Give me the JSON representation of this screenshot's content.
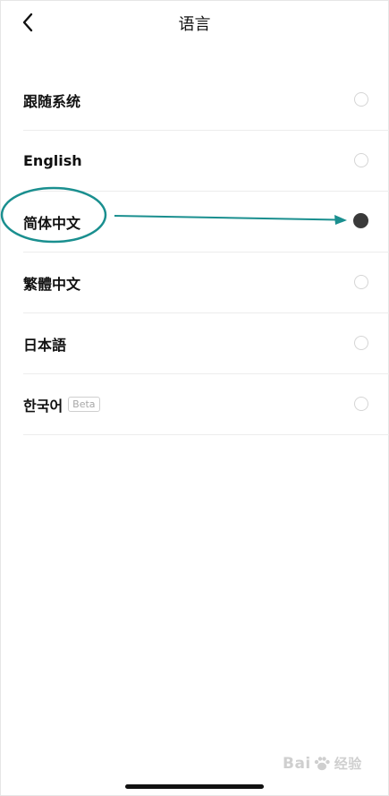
{
  "header": {
    "title": "语言",
    "back_icon": "chevron-left-icon"
  },
  "languages": [
    {
      "label": "跟随系统",
      "selected": false
    },
    {
      "label": "English",
      "selected": false
    },
    {
      "label": "简体中文",
      "selected": true
    },
    {
      "label": "繁體中文",
      "selected": false
    },
    {
      "label": "日本語",
      "selected": false
    },
    {
      "label": "한국어",
      "badge": "Beta",
      "selected": false
    }
  ],
  "annotation": {
    "color": "#1a8f8f",
    "ellipse_target": "简体中文",
    "arrow_target": "selected-radio"
  },
  "watermark": {
    "text_left": "Bai",
    "text_right": "经验"
  },
  "colors": {
    "selected_radio": "#3a3a3a",
    "unselected_radio_border": "#d5d5d5",
    "divider": "#ececec"
  }
}
